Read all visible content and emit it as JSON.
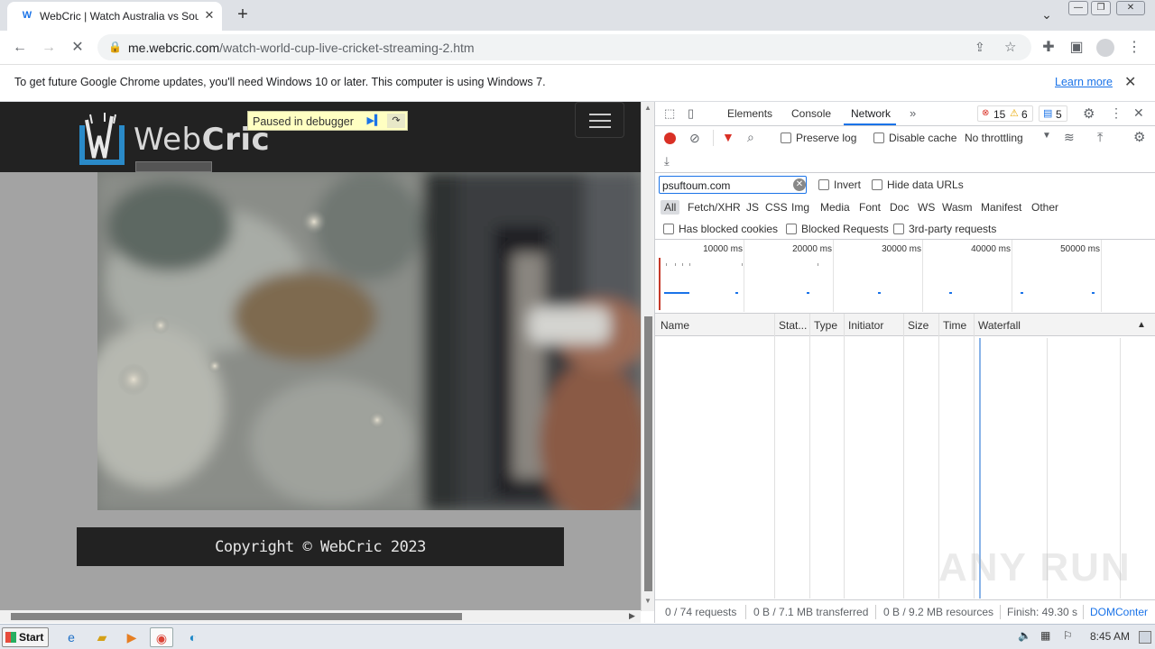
{
  "browser": {
    "tab": {
      "title": "WebCric | Watch Australia vs South",
      "favicon": "W"
    },
    "url": {
      "host": "me.webcric.com",
      "path": "/watch-world-cup-live-cricket-streaming-2.htm"
    },
    "infobar": {
      "message": "To get future Google Chrome updates, you'll need Windows 10 or later. This computer is using Windows 7.",
      "link": "Learn more"
    }
  },
  "page": {
    "logo": {
      "text_light": "Web",
      "text_bold": "Cric"
    },
    "debugger": {
      "label": "Paused in debugger"
    },
    "footer": {
      "copyright": "Copyright © WebCric 2023"
    }
  },
  "devtools": {
    "tabs": [
      "Elements",
      "Console",
      "Network"
    ],
    "active_tab": "Network",
    "errors": "15",
    "warnings": "6",
    "messages": "5",
    "toolbar": {
      "preserve_log": "Preserve log",
      "disable_cache": "Disable cache",
      "throttling": "No throttling"
    },
    "filter": {
      "value": "psuftoum.com",
      "invert": "Invert",
      "hide_data_urls": "Hide data URLs"
    },
    "types": [
      "All",
      "Fetch/XHR",
      "JS",
      "CSS",
      "Img",
      "Media",
      "Font",
      "Doc",
      "WS",
      "Wasm",
      "Manifest",
      "Other"
    ],
    "blocked": {
      "has_blocked_cookies": "Has blocked cookies",
      "blocked_requests": "Blocked Requests",
      "third_party": "3rd-party requests"
    },
    "timeline_labels": [
      "10000 ms",
      "20000 ms",
      "30000 ms",
      "40000 ms",
      "50000 ms"
    ],
    "columns": [
      "Name",
      "Stat...",
      "Type",
      "Initiator",
      "Size",
      "Time",
      "Waterfall"
    ],
    "status": {
      "requests": "0 / 74 requests",
      "transferred": "0 B / 7.1 MB transferred",
      "resources": "0 B / 9.2 MB resources",
      "finish": "Finish: 49.30 s",
      "domcontent": "DOMConter"
    }
  },
  "watermark": "ANY RUN",
  "taskbar": {
    "start": "Start",
    "time": "8:45 AM"
  },
  "colors": {
    "accent": "#1a73e8",
    "record": "#d93025",
    "site_dark": "#222222"
  }
}
